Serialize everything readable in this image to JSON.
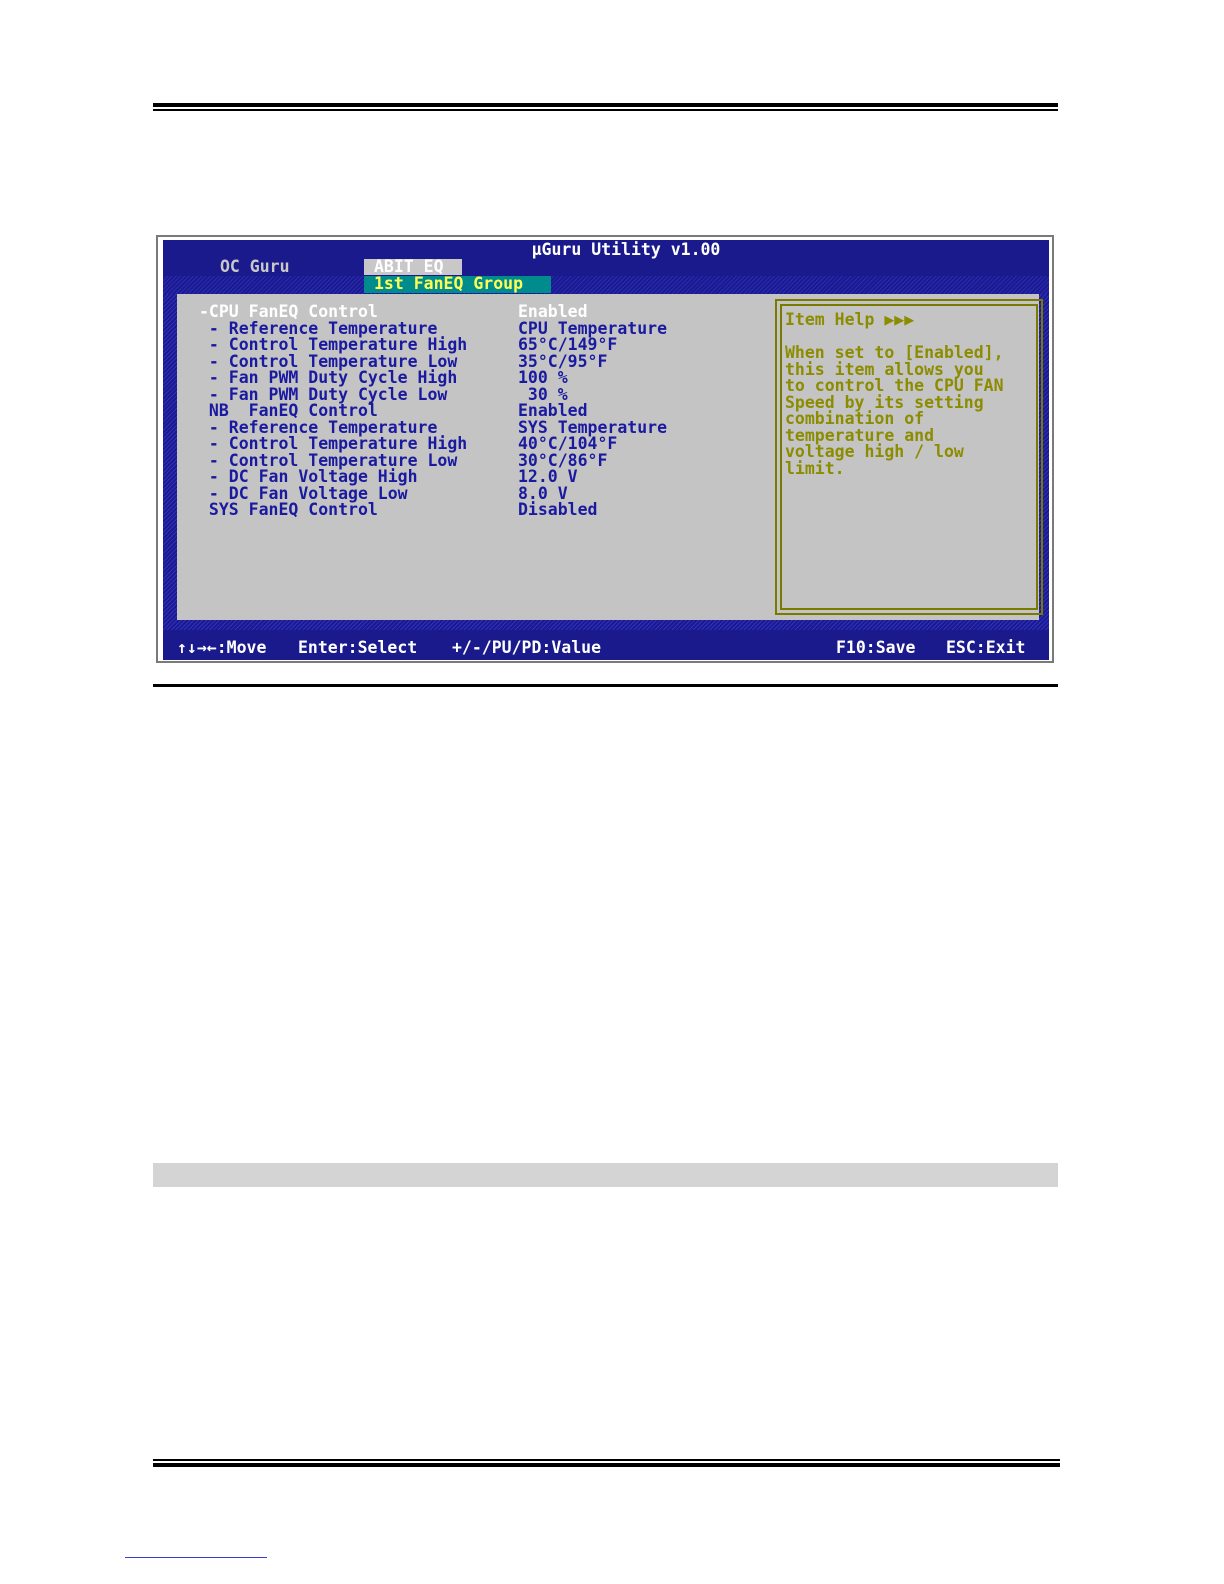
{
  "bios": {
    "title": "µGuru Utility v1.00",
    "tabs": {
      "oc_guru": "OC Guru",
      "abit_eq": "ABIT EQ"
    },
    "group_tab": "1st FanEQ Group",
    "settings": [
      {
        "label": "-CPU FanEQ Control",
        "value": "Enabled",
        "highlighted": true
      },
      {
        "label": " - Reference Temperature",
        "value": "CPU Temperature"
      },
      {
        "label": " - Control Temperature High",
        "value": "65°C/149°F"
      },
      {
        "label": " - Control Temperature Low",
        "value": "35°C/95°F"
      },
      {
        "label": " - Fan PWM Duty Cycle High",
        "value": "100 %"
      },
      {
        "label": " - Fan PWM Duty Cycle Low",
        "value": " 30 %"
      },
      {
        "label": " NB  FanEQ Control",
        "value": "Enabled"
      },
      {
        "label": " - Reference Temperature",
        "value": "SYS Temperature"
      },
      {
        "label": " - Control Temperature High",
        "value": "40°C/104°F"
      },
      {
        "label": " - Control Temperature Low",
        "value": "30°C/86°F"
      },
      {
        "label": " - DC Fan Voltage High",
        "value": "12.0 V"
      },
      {
        "label": " - DC Fan Voltage Low",
        "value": "8.0 V"
      },
      {
        "label": " SYS FanEQ Control",
        "value": "Disabled"
      }
    ],
    "help": {
      "title": "Item Help ▶▶▶",
      "lines": [
        "When set to [Enabled],",
        "this item allows you",
        "to control the CPU FAN",
        "Speed by its setting",
        "combination of",
        "temperature and",
        "voltage high / low",
        "limit."
      ]
    },
    "status_bar": {
      "move": "↑↓→←:Move",
      "select": "Enter:Select",
      "value": "+/-/PU/PD:Value",
      "save": "F10:Save",
      "exit": "ESC:Exit"
    }
  }
}
